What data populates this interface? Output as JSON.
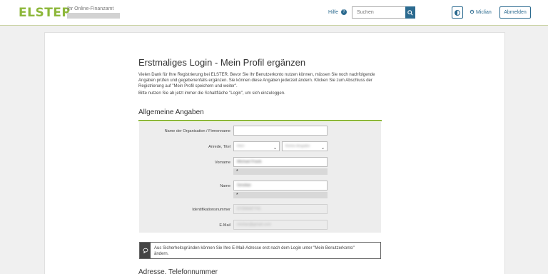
{
  "header": {
    "logo": "ELSTER",
    "logo_sub": "Ihr Online-Finanzamt",
    "help_label": "Hilfe",
    "search_placeholder": "Suchen",
    "user_name": "Miclian",
    "logout_label": "Abmelden"
  },
  "page": {
    "title": "Erstmaliges Login - Mein Profil ergänzen",
    "intro_1": "Vielen Dank für Ihre Registrierung bei ELSTER. Bevor Sie Ihr Benutzerkonto nutzen können, müssen Sie noch nachfolgende Angaben prüfen und gegebenenfalls ergänzen. Sie können diese Angaben jederzeit ändern. Klicken Sie zum Abschluss der Registrierung auf \"Mein Profil speichern und weiter\".",
    "intro_2": "Bitte nutzen Sie ab jetzt immer die Schaltfläche \"Login\", um sich einzuloggen.",
    "section_general": "Allgemeine Angaben",
    "section_address": "Adresse, Telefonnummer"
  },
  "form": {
    "org_label": "Name der Organisation / Firmenname",
    "org_value": "",
    "salutation_label": "Anrede,  Titel",
    "salutation_value": "Herr",
    "title_value": "Keine Angabe",
    "firstname_label": "Vorname",
    "firstname_value": "Michael Frank",
    "name_label": "Name",
    "name_value": "Smolian",
    "star": "*",
    "id_label": "Identifikationsnummer",
    "id_value": "07296587741",
    "email_label": "E-Mail",
    "email_value": "miclian@gmail.com"
  },
  "notice": {
    "text": "Aus Sicherheitsgründen können Sie Ihre E-Mail-Adresse erst nach dem Login unter \"Mein Benutzerkonto\" ändern."
  },
  "colors": {
    "brand_green": "#8db73a",
    "accent_blue": "#2b6a8f"
  }
}
